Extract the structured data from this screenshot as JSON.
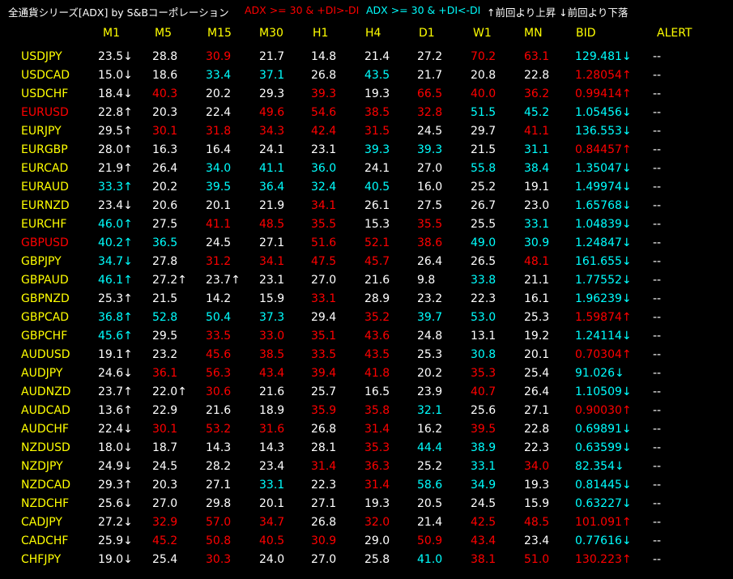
{
  "title": {
    "app": "全通貨シリーズ[ADX] by S&Bコーポレーション",
    "legend_red": "ADX >= 30 & +DI>-DI",
    "legend_cyan": "ADX >= 30 & +DI<-DI",
    "legend_arrows": "↑前回より上昇 ↓前回より下落"
  },
  "colors": {
    "header": "#ffff00",
    "normal": "#ffffff",
    "red": "#ff0000",
    "cyan": "#00ffff",
    "background": "#000000"
  },
  "columns": [
    "M1",
    "M5",
    "M15",
    "M30",
    "H1",
    "H4",
    "D1",
    "W1",
    "MN",
    "BID",
    "ALERT"
  ],
  "rows": [
    {
      "symbol": "USDJPY",
      "sc": "y",
      "cells": [
        [
          "23.5↓",
          "w"
        ],
        [
          "28.8",
          "w"
        ],
        [
          "30.9",
          "r"
        ],
        [
          "21.7",
          "w"
        ],
        [
          "14.8",
          "w"
        ],
        [
          "21.4",
          "w"
        ],
        [
          "27.2",
          "w"
        ],
        [
          "70.2",
          "r"
        ],
        [
          "63.1",
          "r"
        ],
        [
          "129.481↓",
          "c"
        ],
        [
          "--",
          "w"
        ]
      ]
    },
    {
      "symbol": "USDCAD",
      "sc": "y",
      "cells": [
        [
          "15.0↓",
          "w"
        ],
        [
          "18.6",
          "w"
        ],
        [
          "33.4",
          "c"
        ],
        [
          "37.1",
          "c"
        ],
        [
          "26.8",
          "w"
        ],
        [
          "43.5",
          "c"
        ],
        [
          "21.7",
          "w"
        ],
        [
          "20.8",
          "w"
        ],
        [
          "22.8",
          "w"
        ],
        [
          "1.28054↑",
          "r"
        ],
        [
          "--",
          "w"
        ]
      ]
    },
    {
      "symbol": "USDCHF",
      "sc": "y",
      "cells": [
        [
          "18.4↓",
          "w"
        ],
        [
          "40.3",
          "r"
        ],
        [
          "20.2",
          "w"
        ],
        [
          "29.3",
          "w"
        ],
        [
          "39.3",
          "r"
        ],
        [
          "19.3",
          "w"
        ],
        [
          "66.5",
          "r"
        ],
        [
          "40.0",
          "r"
        ],
        [
          "36.2",
          "r"
        ],
        [
          "0.99414↑",
          "r"
        ],
        [
          "--",
          "w"
        ]
      ]
    },
    {
      "symbol": "EURUSD",
      "sc": "r",
      "cells": [
        [
          "22.8↑",
          "w"
        ],
        [
          "20.3",
          "w"
        ],
        [
          "22.4",
          "w"
        ],
        [
          "49.6",
          "r"
        ],
        [
          "54.6",
          "r"
        ],
        [
          "38.5",
          "r"
        ],
        [
          "32.8",
          "r"
        ],
        [
          "51.5",
          "c"
        ],
        [
          "45.2",
          "c"
        ],
        [
          "1.05456↓",
          "c"
        ],
        [
          "--",
          "w"
        ]
      ]
    },
    {
      "symbol": "EURJPY",
      "sc": "y",
      "cells": [
        [
          "29.5↑",
          "w"
        ],
        [
          "30.1",
          "r"
        ],
        [
          "31.8",
          "r"
        ],
        [
          "34.3",
          "r"
        ],
        [
          "42.4",
          "r"
        ],
        [
          "31.5",
          "r"
        ],
        [
          "24.5",
          "w"
        ],
        [
          "29.7",
          "w"
        ],
        [
          "41.1",
          "r"
        ],
        [
          "136.553↓",
          "c"
        ],
        [
          "--",
          "w"
        ]
      ]
    },
    {
      "symbol": "EURGBP",
      "sc": "y",
      "cells": [
        [
          "28.0↑",
          "w"
        ],
        [
          "16.3",
          "w"
        ],
        [
          "16.4",
          "w"
        ],
        [
          "24.1",
          "w"
        ],
        [
          "23.1",
          "w"
        ],
        [
          "39.3",
          "c"
        ],
        [
          "39.3",
          "c"
        ],
        [
          "21.5",
          "w"
        ],
        [
          "31.1",
          "c"
        ],
        [
          "0.84457↑",
          "r"
        ],
        [
          "--",
          "w"
        ]
      ]
    },
    {
      "symbol": "EURCAD",
      "sc": "y",
      "cells": [
        [
          "21.9↑",
          "w"
        ],
        [
          "26.4",
          "w"
        ],
        [
          "34.0",
          "c"
        ],
        [
          "41.1",
          "c"
        ],
        [
          "36.0",
          "c"
        ],
        [
          "24.1",
          "w"
        ],
        [
          "27.0",
          "w"
        ],
        [
          "55.8",
          "c"
        ],
        [
          "38.4",
          "c"
        ],
        [
          "1.35047↓",
          "c"
        ],
        [
          "--",
          "w"
        ]
      ]
    },
    {
      "symbol": "EURAUD",
      "sc": "y",
      "cells": [
        [
          "33.3↑",
          "c"
        ],
        [
          "20.2",
          "w"
        ],
        [
          "39.5",
          "c"
        ],
        [
          "36.4",
          "c"
        ],
        [
          "32.4",
          "c"
        ],
        [
          "40.5",
          "c"
        ],
        [
          "16.0",
          "w"
        ],
        [
          "25.2",
          "w"
        ],
        [
          "19.1",
          "w"
        ],
        [
          "1.49974↓",
          "c"
        ],
        [
          "--",
          "w"
        ]
      ]
    },
    {
      "symbol": "EURNZD",
      "sc": "y",
      "cells": [
        [
          "23.4↓",
          "w"
        ],
        [
          "20.6",
          "w"
        ],
        [
          "20.1",
          "w"
        ],
        [
          "21.9",
          "w"
        ],
        [
          "34.1",
          "r"
        ],
        [
          "26.1",
          "w"
        ],
        [
          "27.5",
          "w"
        ],
        [
          "26.7",
          "w"
        ],
        [
          "23.0",
          "w"
        ],
        [
          "1.65768↓",
          "c"
        ],
        [
          "--",
          "w"
        ]
      ]
    },
    {
      "symbol": "EURCHF",
      "sc": "y",
      "cells": [
        [
          "46.0↑",
          "c"
        ],
        [
          "27.5",
          "w"
        ],
        [
          "41.1",
          "r"
        ],
        [
          "48.5",
          "r"
        ],
        [
          "35.5",
          "r"
        ],
        [
          "15.3",
          "w"
        ],
        [
          "35.5",
          "r"
        ],
        [
          "25.5",
          "w"
        ],
        [
          "33.1",
          "c"
        ],
        [
          "1.04839↓",
          "c"
        ],
        [
          "--",
          "w"
        ]
      ]
    },
    {
      "symbol": "GBPUSD",
      "sc": "r",
      "cells": [
        [
          "40.2↑",
          "c"
        ],
        [
          "36.5",
          "c"
        ],
        [
          "24.5",
          "w"
        ],
        [
          "27.1",
          "w"
        ],
        [
          "51.6",
          "r"
        ],
        [
          "52.1",
          "r"
        ],
        [
          "38.6",
          "r"
        ],
        [
          "49.0",
          "c"
        ],
        [
          "30.9",
          "c"
        ],
        [
          "1.24847↓",
          "c"
        ],
        [
          "--",
          "w"
        ]
      ]
    },
    {
      "symbol": "GBPJPY",
      "sc": "y",
      "cells": [
        [
          "34.7↓",
          "c"
        ],
        [
          "27.8",
          "w"
        ],
        [
          "31.2",
          "r"
        ],
        [
          "34.1",
          "r"
        ],
        [
          "47.5",
          "r"
        ],
        [
          "45.7",
          "r"
        ],
        [
          "26.4",
          "w"
        ],
        [
          "26.5",
          "w"
        ],
        [
          "48.1",
          "r"
        ],
        [
          "161.655↓",
          "c"
        ],
        [
          "--",
          "w"
        ]
      ]
    },
    {
      "symbol": "GBPAUD",
      "sc": "y",
      "cells": [
        [
          "46.1↑",
          "c"
        ],
        [
          "27.2↑",
          "w"
        ],
        [
          "23.7↑",
          "w"
        ],
        [
          "23.1",
          "w"
        ],
        [
          "27.0",
          "w"
        ],
        [
          "21.6",
          "w"
        ],
        [
          "9.8",
          "w"
        ],
        [
          "33.8",
          "c"
        ],
        [
          "21.1",
          "w"
        ],
        [
          "1.77552↓",
          "c"
        ],
        [
          "--",
          "w"
        ]
      ]
    },
    {
      "symbol": "GBPNZD",
      "sc": "y",
      "cells": [
        [
          "25.3↑",
          "w"
        ],
        [
          "21.5",
          "w"
        ],
        [
          "14.2",
          "w"
        ],
        [
          "15.9",
          "w"
        ],
        [
          "33.1",
          "r"
        ],
        [
          "28.9",
          "w"
        ],
        [
          "23.2",
          "w"
        ],
        [
          "22.3",
          "w"
        ],
        [
          "16.1",
          "w"
        ],
        [
          "1.96239↓",
          "c"
        ],
        [
          "--",
          "w"
        ]
      ]
    },
    {
      "symbol": "GBPCAD",
      "sc": "y",
      "cells": [
        [
          "36.8↑",
          "c"
        ],
        [
          "52.8",
          "c"
        ],
        [
          "50.4",
          "c"
        ],
        [
          "37.3",
          "c"
        ],
        [
          "29.4",
          "w"
        ],
        [
          "35.2",
          "r"
        ],
        [
          "39.7",
          "c"
        ],
        [
          "53.0",
          "c"
        ],
        [
          "25.3",
          "w"
        ],
        [
          "1.59874↑",
          "r"
        ],
        [
          "--",
          "w"
        ]
      ]
    },
    {
      "symbol": "GBPCHF",
      "sc": "y",
      "cells": [
        [
          "45.6↑",
          "c"
        ],
        [
          "29.5",
          "w"
        ],
        [
          "33.5",
          "r"
        ],
        [
          "33.0",
          "r"
        ],
        [
          "35.1",
          "r"
        ],
        [
          "43.6",
          "r"
        ],
        [
          "24.8",
          "w"
        ],
        [
          "13.1",
          "w"
        ],
        [
          "19.2",
          "w"
        ],
        [
          "1.24114↓",
          "c"
        ],
        [
          "--",
          "w"
        ]
      ]
    },
    {
      "symbol": "AUDUSD",
      "sc": "y",
      "cells": [
        [
          "19.1↑",
          "w"
        ],
        [
          "23.2",
          "w"
        ],
        [
          "45.6",
          "r"
        ],
        [
          "38.5",
          "r"
        ],
        [
          "33.5",
          "r"
        ],
        [
          "43.5",
          "r"
        ],
        [
          "25.3",
          "w"
        ],
        [
          "30.8",
          "c"
        ],
        [
          "20.1",
          "w"
        ],
        [
          "0.70304↑",
          "r"
        ],
        [
          "--",
          "w"
        ]
      ]
    },
    {
      "symbol": "AUDJPY",
      "sc": "y",
      "cells": [
        [
          "24.6↓",
          "w"
        ],
        [
          "36.1",
          "r"
        ],
        [
          "56.3",
          "r"
        ],
        [
          "43.4",
          "r"
        ],
        [
          "39.4",
          "r"
        ],
        [
          "41.8",
          "r"
        ],
        [
          "20.2",
          "w"
        ],
        [
          "35.3",
          "r"
        ],
        [
          "25.4",
          "w"
        ],
        [
          "91.026↓",
          "c"
        ],
        [
          "--",
          "w"
        ]
      ]
    },
    {
      "symbol": "AUDNZD",
      "sc": "y",
      "cells": [
        [
          "23.7↑",
          "w"
        ],
        [
          "22.0↑",
          "w"
        ],
        [
          "30.6",
          "r"
        ],
        [
          "21.6",
          "w"
        ],
        [
          "25.7",
          "w"
        ],
        [
          "16.5",
          "w"
        ],
        [
          "23.9",
          "w"
        ],
        [
          "40.7",
          "r"
        ],
        [
          "26.4",
          "w"
        ],
        [
          "1.10509↓",
          "c"
        ],
        [
          "--",
          "w"
        ]
      ]
    },
    {
      "symbol": "AUDCAD",
      "sc": "y",
      "cells": [
        [
          "13.6↑",
          "w"
        ],
        [
          "22.9",
          "w"
        ],
        [
          "21.6",
          "w"
        ],
        [
          "18.9",
          "w"
        ],
        [
          "35.9",
          "r"
        ],
        [
          "35.8",
          "r"
        ],
        [
          "32.1",
          "c"
        ],
        [
          "25.6",
          "w"
        ],
        [
          "27.1",
          "w"
        ],
        [
          "0.90030↑",
          "r"
        ],
        [
          "--",
          "w"
        ]
      ]
    },
    {
      "symbol": "AUDCHF",
      "sc": "y",
      "cells": [
        [
          "22.4↓",
          "w"
        ],
        [
          "30.1",
          "r"
        ],
        [
          "53.2",
          "r"
        ],
        [
          "31.6",
          "r"
        ],
        [
          "26.8",
          "w"
        ],
        [
          "31.4",
          "r"
        ],
        [
          "16.2",
          "w"
        ],
        [
          "39.5",
          "r"
        ],
        [
          "22.8",
          "w"
        ],
        [
          "0.69891↓",
          "c"
        ],
        [
          "--",
          "w"
        ]
      ]
    },
    {
      "symbol": "NZDUSD",
      "sc": "y",
      "cells": [
        [
          "18.0↓",
          "w"
        ],
        [
          "18.7",
          "w"
        ],
        [
          "14.3",
          "w"
        ],
        [
          "14.3",
          "w"
        ],
        [
          "28.1",
          "w"
        ],
        [
          "35.3",
          "r"
        ],
        [
          "44.4",
          "c"
        ],
        [
          "38.9",
          "c"
        ],
        [
          "22.3",
          "w"
        ],
        [
          "0.63599↓",
          "c"
        ],
        [
          "--",
          "w"
        ]
      ]
    },
    {
      "symbol": "NZDJPY",
      "sc": "y",
      "cells": [
        [
          "24.9↓",
          "w"
        ],
        [
          "24.5",
          "w"
        ],
        [
          "28.2",
          "w"
        ],
        [
          "23.4",
          "w"
        ],
        [
          "31.4",
          "r"
        ],
        [
          "36.3",
          "r"
        ],
        [
          "25.2",
          "w"
        ],
        [
          "33.1",
          "c"
        ],
        [
          "34.0",
          "r"
        ],
        [
          "82.354↓",
          "c"
        ],
        [
          "--",
          "w"
        ]
      ]
    },
    {
      "symbol": "NZDCAD",
      "sc": "y",
      "cells": [
        [
          "29.3↑",
          "w"
        ],
        [
          "20.3",
          "w"
        ],
        [
          "27.1",
          "w"
        ],
        [
          "33.1",
          "c"
        ],
        [
          "22.3",
          "w"
        ],
        [
          "31.4",
          "r"
        ],
        [
          "58.6",
          "c"
        ],
        [
          "34.9",
          "c"
        ],
        [
          "19.3",
          "w"
        ],
        [
          "0.81445↓",
          "c"
        ],
        [
          "--",
          "w"
        ]
      ]
    },
    {
      "symbol": "NZDCHF",
      "sc": "y",
      "cells": [
        [
          "25.6↓",
          "w"
        ],
        [
          "27.0",
          "w"
        ],
        [
          "29.8",
          "w"
        ],
        [
          "20.1",
          "w"
        ],
        [
          "27.1",
          "w"
        ],
        [
          "19.3",
          "w"
        ],
        [
          "20.5",
          "w"
        ],
        [
          "24.5",
          "w"
        ],
        [
          "15.9",
          "w"
        ],
        [
          "0.63227↓",
          "c"
        ],
        [
          "--",
          "w"
        ]
      ]
    },
    {
      "symbol": "CADJPY",
      "sc": "y",
      "cells": [
        [
          "27.2↓",
          "w"
        ],
        [
          "32.9",
          "r"
        ],
        [
          "57.0",
          "r"
        ],
        [
          "34.7",
          "r"
        ],
        [
          "26.8",
          "w"
        ],
        [
          "32.0",
          "r"
        ],
        [
          "21.4",
          "w"
        ],
        [
          "42.5",
          "r"
        ],
        [
          "48.5",
          "r"
        ],
        [
          "101.091↑",
          "r"
        ],
        [
          "--",
          "w"
        ]
      ]
    },
    {
      "symbol": "CADCHF",
      "sc": "y",
      "cells": [
        [
          "25.9↓",
          "w"
        ],
        [
          "45.2",
          "r"
        ],
        [
          "50.8",
          "r"
        ],
        [
          "40.5",
          "r"
        ],
        [
          "30.9",
          "r"
        ],
        [
          "29.0",
          "w"
        ],
        [
          "50.9",
          "r"
        ],
        [
          "43.4",
          "r"
        ],
        [
          "23.4",
          "w"
        ],
        [
          "0.77616↓",
          "c"
        ],
        [
          "--",
          "w"
        ]
      ]
    },
    {
      "symbol": "CHFJPY",
      "sc": "y",
      "cells": [
        [
          "19.0↓",
          "w"
        ],
        [
          "25.4",
          "w"
        ],
        [
          "30.3",
          "r"
        ],
        [
          "24.0",
          "w"
        ],
        [
          "27.0",
          "w"
        ],
        [
          "25.8",
          "w"
        ],
        [
          "41.0",
          "c"
        ],
        [
          "38.1",
          "r"
        ],
        [
          "51.0",
          "r"
        ],
        [
          "130.223↑",
          "r"
        ],
        [
          "--",
          "w"
        ]
      ]
    }
  ]
}
